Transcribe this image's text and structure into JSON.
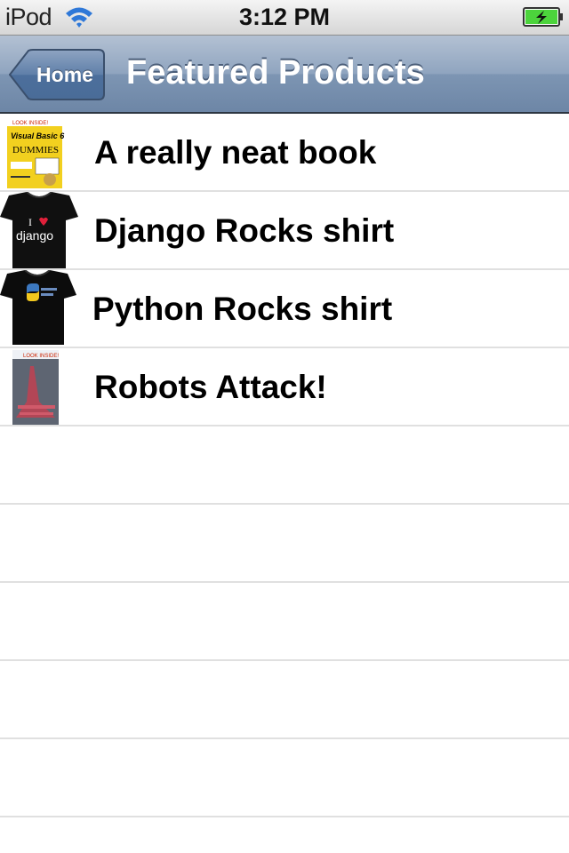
{
  "status_bar": {
    "carrier": "iPod",
    "time": "3:12 PM",
    "wifi_icon": "wifi-icon",
    "battery_icon": "battery-charging-icon"
  },
  "nav_bar": {
    "back_label": "Home",
    "title": "Featured Products"
  },
  "products": [
    {
      "name": "A really neat book",
      "thumbnail": "book-cover-visual-basic-dummies",
      "thumb_text": {
        "top": "LOOK INSIDE!",
        "title": "Visual Basic 6",
        "brand": "DUMMIES"
      }
    },
    {
      "name": "Django Rocks shirt",
      "thumbnail": "django-shirt",
      "thumb_text": {
        "line1": "I",
        "line2": "django"
      }
    },
    {
      "name": "Python Rocks shirt",
      "thumbnail": "python-shirt"
    },
    {
      "name": "Robots Attack!",
      "thumbnail": "book-cover-robots-attack",
      "thumb_text": {
        "top": "LOOK INSIDE!"
      }
    }
  ],
  "empty_rows": 6,
  "colors": {
    "nav_top": "#b3c1d3",
    "nav_bottom": "#6d86a6",
    "separator": "#e0e0e0",
    "battery_fill": "#4cd43c"
  }
}
